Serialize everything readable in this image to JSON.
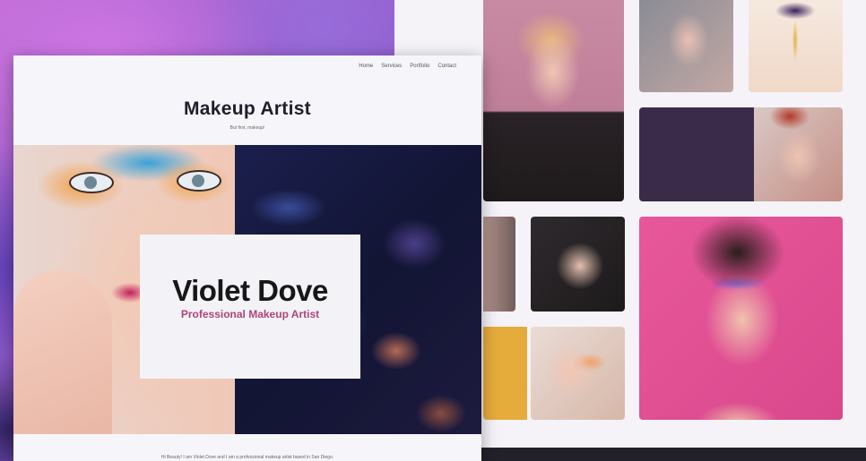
{
  "front": {
    "nav": [
      "Home",
      "Services",
      "Portfolio",
      "Contact"
    ],
    "title": "Makeup Artist",
    "tagline": "But first, makeup!",
    "card": {
      "name": "Violet Dove",
      "role": "Professional Makeup Artist"
    },
    "intro": "Hi Beauty! I am Violet Dove and I am a professional makeup artist based in San Diego."
  },
  "colors": {
    "accent": "#b0437a",
    "title": "#1f1f2a",
    "gallery_bg": "#f5f3f8",
    "dark_panel": "#3a2b4a",
    "pink_panel": "#e25597",
    "yellow_panel": "#e5ab3b"
  }
}
